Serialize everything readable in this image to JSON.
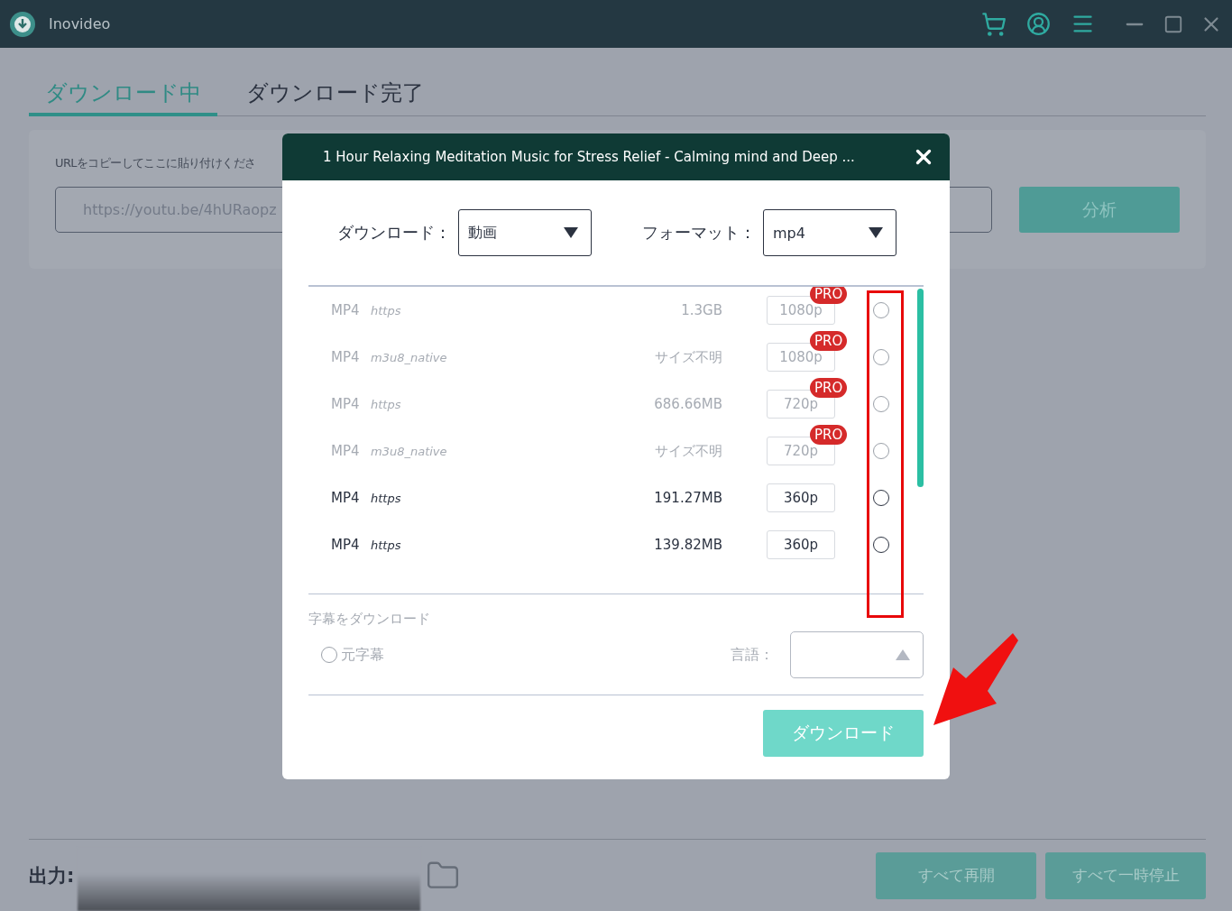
{
  "app": {
    "title": "Inovideo"
  },
  "tabs": [
    {
      "label": "ダウンロード中",
      "selected": true
    },
    {
      "label": "ダウンロード完了",
      "selected": false
    }
  ],
  "url_panel": {
    "label": "URLをコピーしてここに貼り付けくださ",
    "value": "https://youtu.be/4hURaopz",
    "button": "分析"
  },
  "output": {
    "label": "出力:"
  },
  "bulk_buttons": [
    "すべて再開",
    "すべて一時停止"
  ],
  "dialog": {
    "title": "1 Hour Relaxing Meditation Music for Stress Relief - Calming mind and Deep ...",
    "download_select": {
      "label": "ダウンロード：",
      "value": "動画"
    },
    "format_select": {
      "label": "フォーマット：",
      "value": "mp4"
    },
    "formats": [
      {
        "type": "MP4",
        "protocol": "https",
        "size": "1.3GB",
        "quality": "1080p",
        "badge": "PRO",
        "disabled": true,
        "selected": false
      },
      {
        "type": "MP4",
        "protocol": "m3u8_native",
        "size": "サイズ不明",
        "quality": "1080p",
        "badge": "PRO",
        "disabled": true,
        "selected": false
      },
      {
        "type": "MP4",
        "protocol": "https",
        "size": "686.66MB",
        "quality": "720p",
        "badge": "PRO",
        "disabled": true,
        "selected": false
      },
      {
        "type": "MP4",
        "protocol": "m3u8_native",
        "size": "サイズ不明",
        "quality": "720p",
        "badge": "PRO",
        "disabled": true,
        "selected": false
      },
      {
        "type": "MP4",
        "protocol": "https",
        "size": "191.27MB",
        "quality": "360p",
        "disabled": false,
        "selected": false
      },
      {
        "type": "MP4",
        "protocol": "https",
        "size": "139.82MB",
        "quality": "360p",
        "disabled": false,
        "selected": false
      }
    ],
    "subtitles": {
      "heading": "字幕をダウンロード",
      "option": {
        "label": "元字幕",
        "selected": false
      },
      "language_label": "言語："
    },
    "download_button": "ダウンロード"
  }
}
